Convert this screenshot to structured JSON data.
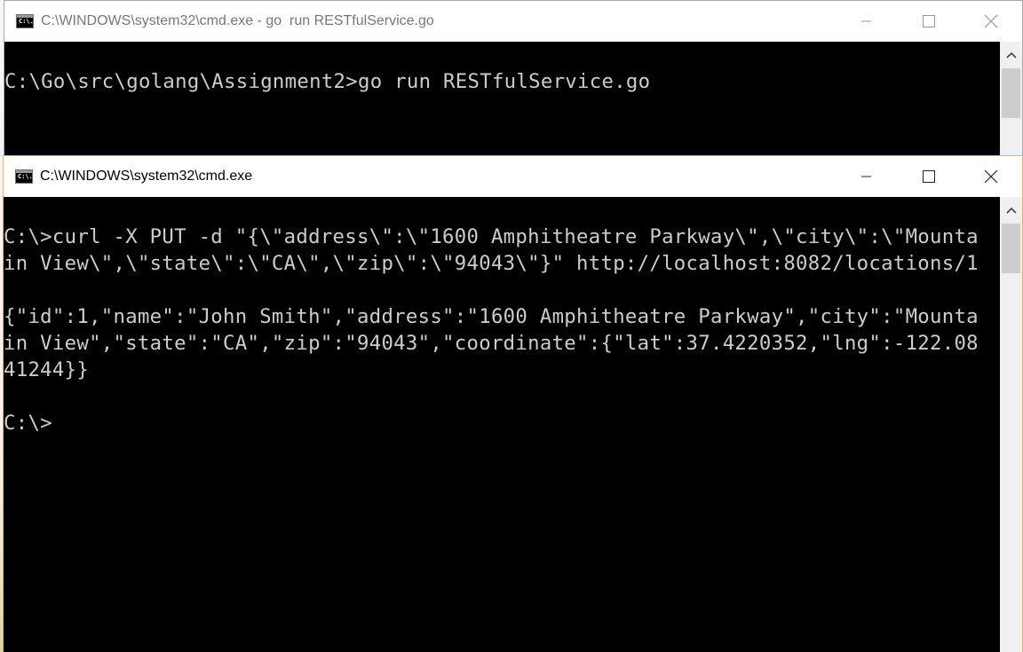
{
  "back_window": {
    "title": "C:\\WINDOWS\\system32\\cmd.exe - go  run RESTfulService.go",
    "icon_label": "C:\\.",
    "lines": [
      "",
      "C:\\Go\\src\\golang\\Assignment2>go run RESTfulService.go"
    ]
  },
  "front_window": {
    "title": "C:\\WINDOWS\\system32\\cmd.exe",
    "icon_label": "C:\\.",
    "lines": [
      "",
      "C:\\>curl -X PUT -d \"{\\\"address\\\":\\\"1600 Amphitheatre Parkway\\\",\\\"city\\\":\\\"Mounta",
      "in View\\\",\\\"state\\\":\\\"CA\\\",\\\"zip\\\":\\\"94043\\\"}\" http://localhost:8082/locations/1",
      "",
      "{\"id\":1,\"name\":\"John Smith\",\"address\":\"1600 Amphitheatre Parkway\",\"city\":\"Mounta",
      "in View\",\"state\":\"CA\",\"zip\":\"94043\",\"coordinate\":{\"lat\":37.4220352,\"lng\":-122.08",
      "41244}}",
      "",
      "C:\\>"
    ]
  },
  "icons": {
    "minimize": "minimize-icon",
    "maximize": "maximize-icon",
    "close": "close-icon",
    "scroll_up": "scroll-up-arrow-icon",
    "app": "cmd-app-icon"
  },
  "colors": {
    "console_bg": "#000000",
    "console_text": "#cccccc",
    "active_border": "#e3b078",
    "inactive_title": "#777777"
  }
}
